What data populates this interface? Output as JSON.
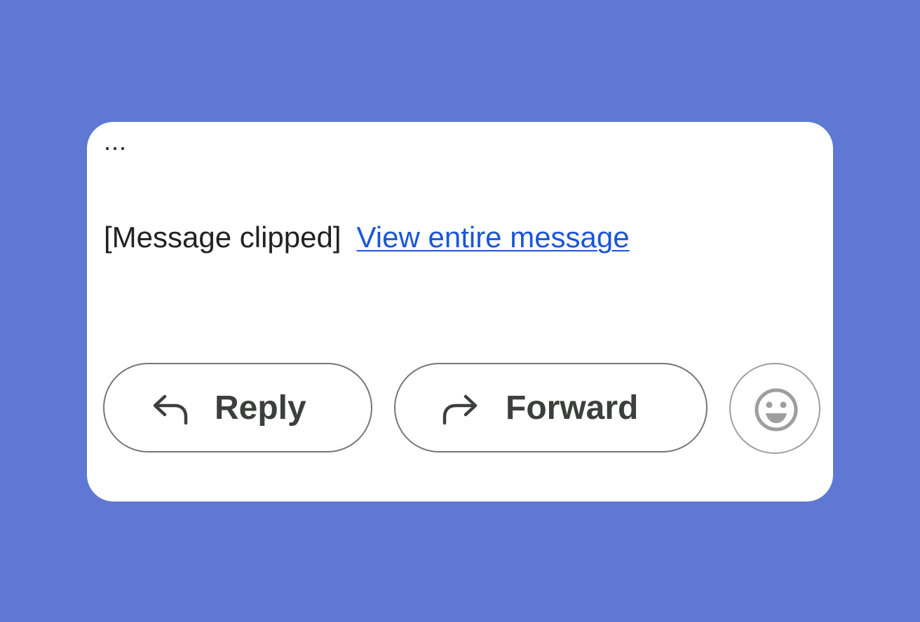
{
  "message": {
    "ellipsis": "...",
    "clipped_text": "[Message clipped]",
    "view_link": "View entire message"
  },
  "actions": {
    "reply_label": "Reply",
    "forward_label": "Forward",
    "reply_icon": "reply-arrow-icon",
    "forward_icon": "forward-arrow-icon",
    "emoji_icon": "smiley-face-icon"
  },
  "colors": {
    "background": "#5e78d3",
    "card": "#ffffff",
    "link": "#1a57d6",
    "text": "#222222",
    "button_text": "#3c403d",
    "button_border": "#747775",
    "emoji_gray": "#9e9e9e"
  }
}
